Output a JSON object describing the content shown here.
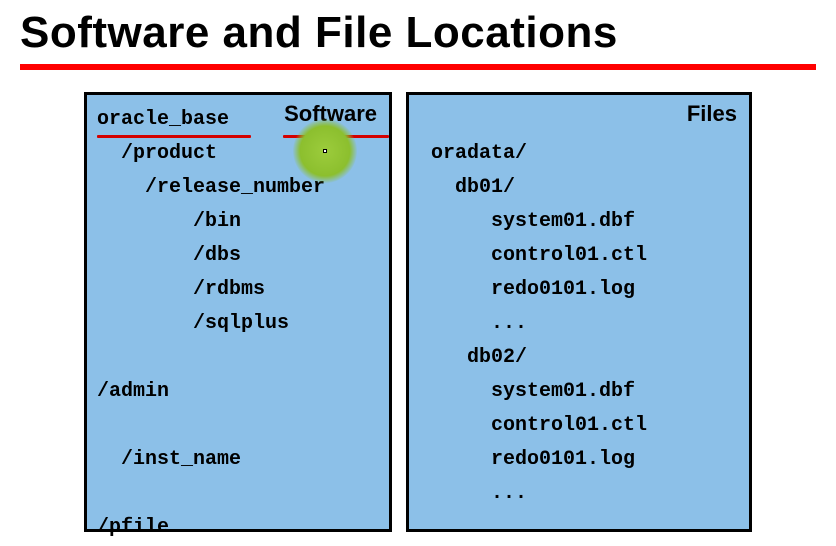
{
  "title": "Software and File Locations",
  "left": {
    "label": "Software",
    "lines": {
      "l0": "oracle_base",
      "l1": "  /product",
      "l2": "    /release_number",
      "l3": "        /bin",
      "l4": "        /dbs",
      "l5": "        /rdbms",
      "l6": "        /sqlplus",
      "l7": " ",
      "l8": "/admin",
      "l9": " ",
      "l10": "  /inst_name",
      "l11": " ",
      "l12": "/pfile"
    }
  },
  "right": {
    "label": "Files",
    "lines": {
      "r0": " ",
      "r1": " oradata/",
      "r2": "   db01/",
      "r3": "      system01.dbf",
      "r4": "      control01.ctl",
      "r5": "      redo0101.log",
      "r6": "      ...",
      "r7": "    db02/",
      "r8": "      system01.dbf",
      "r9": "      control01.ctl",
      "r10": "      redo0101.log",
      "r11": "      ..."
    }
  }
}
